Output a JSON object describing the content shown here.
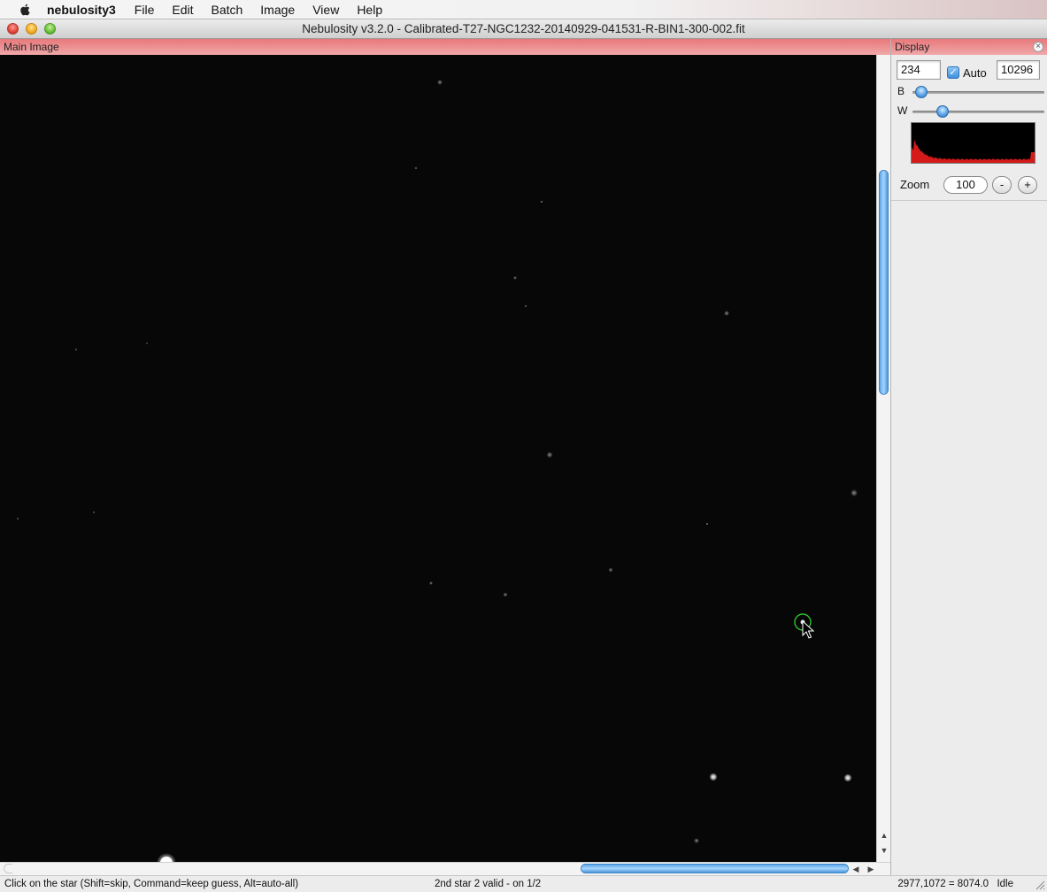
{
  "menubar": {
    "app_name": "nebulosity3",
    "items": [
      {
        "label": "File"
      },
      {
        "label": "Edit"
      },
      {
        "label": "Batch"
      },
      {
        "label": "Image"
      },
      {
        "label": "View"
      },
      {
        "label": "Help"
      }
    ]
  },
  "window": {
    "title": "Nebulosity v3.2.0 - Calibrated-T27-NGC1232-20140929-041531-R-BIN1-300-002.fit"
  },
  "main_panel": {
    "header": "Main Image",
    "icons": {
      "vscroll_up": "triangle-up-icon",
      "vscroll_down": "triangle-down-icon",
      "hscroll_left": "triangle-left-icon",
      "hscroll_right": "triangle-right-icon"
    }
  },
  "display_panel": {
    "header": "Display",
    "black_value": "234",
    "auto_label": "Auto",
    "auto_checked": true,
    "white_value": "10296",
    "b_label": "B",
    "w_label": "W",
    "b_level": 0.02,
    "w_level": 0.2,
    "zoom_label": "Zoom",
    "zoom_value": "100",
    "zoom_minus": "-",
    "zoom_plus": "+",
    "histogram_color": "#d41a1a"
  },
  "statusbar": {
    "instruction": "Click on the star (Shift=skip, Command=keep guess, Alt=auto-all)",
    "progress": "2nd star 2 valid - on 1/2",
    "pixel_readout": "2977,1072 = 8074.0",
    "state": "Idle"
  },
  "colors": {
    "panel_header": "#e8787a",
    "scroll_thumb": "#5aa6ea",
    "selection_circle": "#2fbf2f"
  }
}
